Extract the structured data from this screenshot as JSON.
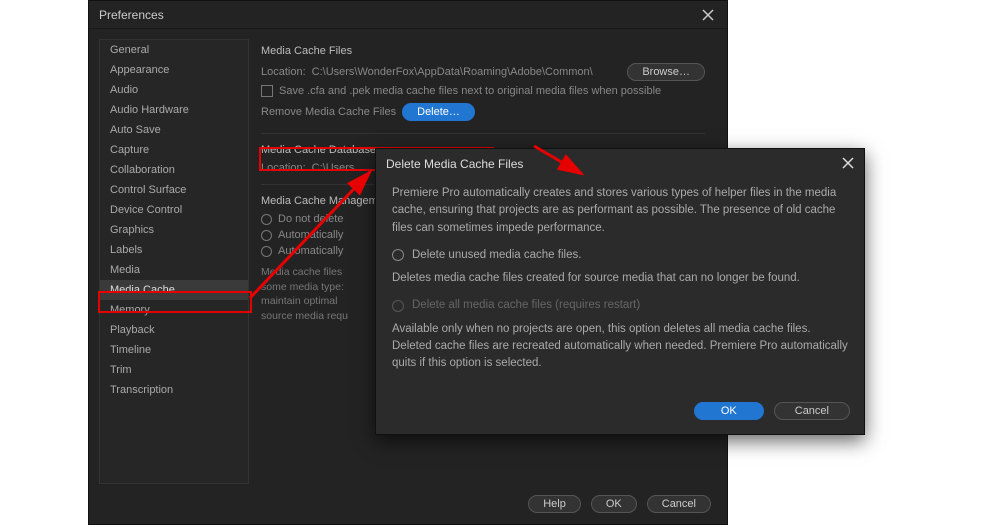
{
  "pref": {
    "title": "Preferences",
    "sidebar": {
      "items": [
        "General",
        "Appearance",
        "Audio",
        "Audio Hardware",
        "Auto Save",
        "Capture",
        "Collaboration",
        "Control Surface",
        "Device Control",
        "Graphics",
        "Labels",
        "Media",
        "Media Cache",
        "Memory",
        "Playback",
        "Timeline",
        "Trim",
        "Transcription"
      ],
      "selected_index": 12
    },
    "mcf": {
      "title": "Media Cache Files",
      "location_label": "Location:",
      "location_value": "C:\\Users\\WonderFox\\AppData\\Roaming\\Adobe\\Common\\",
      "browse": "Browse…",
      "save_next": "Save .cfa and .pek media cache files next to original media files when possible",
      "remove_label": "Remove Media Cache Files",
      "delete": "Delete…"
    },
    "mcd": {
      "title": "Media Cache Database",
      "location_label": "Location:",
      "location_value": "C:\\Users"
    },
    "mcm": {
      "title": "Media Cache Management",
      "opt1": "Do not delete",
      "opt2": "Automatically",
      "opt3": "Automatically"
    },
    "footnote": "Media cache files\nsome media type:\nmaintain optimal\nsource media requ",
    "footer": {
      "help": "Help",
      "ok": "OK",
      "cancel": "Cancel"
    }
  },
  "modal": {
    "title": "Delete Media Cache Files",
    "intro": "Premiere Pro automatically creates and stores various types of helper files in the media cache, ensuring that projects are as performant as possible. The presence of old cache files can sometimes impede performance.",
    "opt1": "Delete unused media cache files.",
    "opt1_desc": "Deletes media cache files created for source media that can no longer be found.",
    "opt2": "Delete all media cache files (requires restart)",
    "opt2_desc": "Available only when no projects are open, this option deletes all media cache files. Deleted cache files are recreated automatically when needed. Premiere Pro automatically quits if this option is selected.",
    "ok": "OK",
    "cancel": "Cancel"
  }
}
